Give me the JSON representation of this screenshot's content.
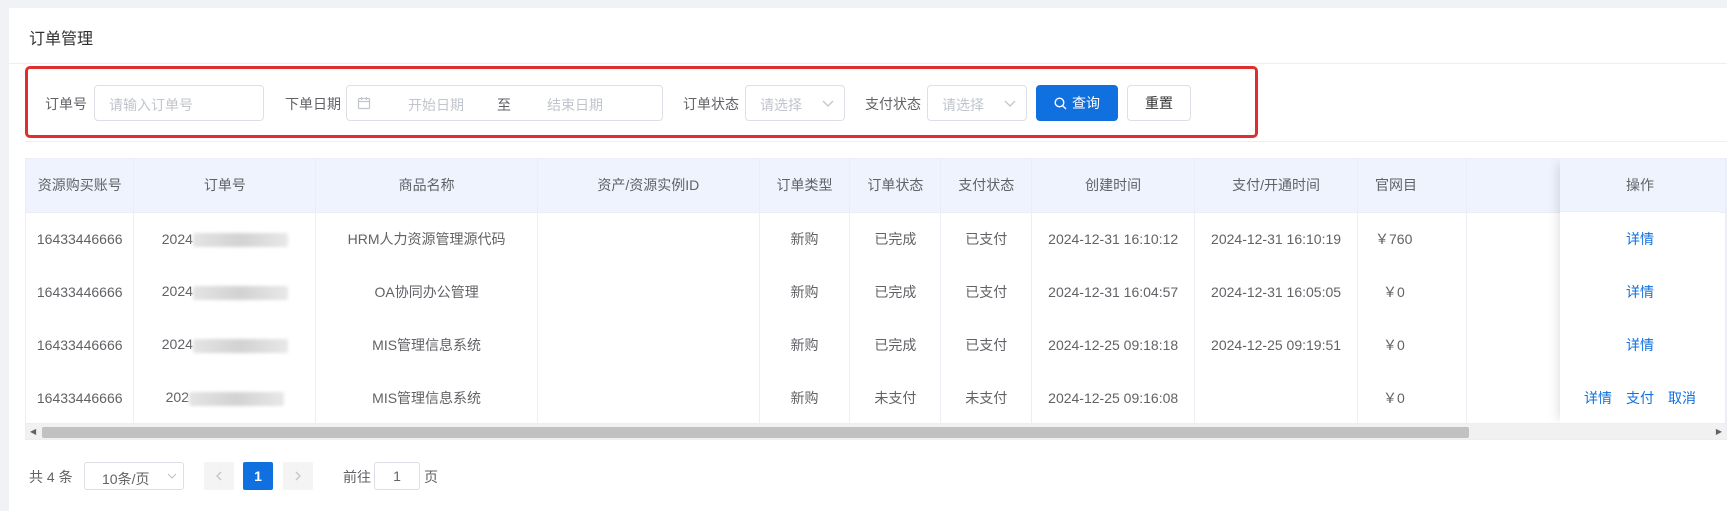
{
  "page": {
    "title": "订单管理"
  },
  "filters": {
    "order_no": {
      "label": "订单号",
      "placeholder": "请输入订单号"
    },
    "order_date": {
      "label": "下单日期",
      "start_placeholder": "开始日期",
      "separator": "至",
      "end_placeholder": "结束日期"
    },
    "order_status": {
      "label": "订单状态",
      "placeholder": "请选择"
    },
    "pay_status": {
      "label": "支付状态",
      "placeholder": "请选择"
    },
    "search_label": "查询",
    "reset_label": "重置"
  },
  "table": {
    "columns": [
      "资源购买账号",
      "订单号",
      "商品名称",
      "资产/资源实例ID",
      "订单类型",
      "订单状态",
      "支付状态",
      "创建时间",
      "支付/开通时间",
      "官网目"
    ],
    "action_header": "操作",
    "rows": [
      {
        "account": "16433446666",
        "order_prefix": "2024",
        "product": "HRM人力资源管理源代码",
        "asset_id": "",
        "type": "新购",
        "status": "已完成",
        "pay": "已支付",
        "created": "2024-12-31 16:10:12",
        "paid": "2024-12-31 16:10:19",
        "price": "￥760",
        "actions": [
          "详情"
        ]
      },
      {
        "account": "16433446666",
        "order_prefix": "2024",
        "product": "OA协同办公管理",
        "asset_id": "",
        "type": "新购",
        "status": "已完成",
        "pay": "已支付",
        "created": "2024-12-31 16:04:57",
        "paid": "2024-12-31 16:05:05",
        "price": "￥0",
        "actions": [
          "详情"
        ]
      },
      {
        "account": "16433446666",
        "order_prefix": "2024",
        "product": "MIS管理信息系统",
        "asset_id": "",
        "type": "新购",
        "status": "已完成",
        "pay": "已支付",
        "created": "2024-12-25 09:18:18",
        "paid": "2024-12-25 09:19:51",
        "price": "￥0",
        "actions": [
          "详情"
        ]
      },
      {
        "account": "16433446666",
        "order_prefix": "202",
        "product": "MIS管理信息系统",
        "asset_id": "",
        "type": "新购",
        "status": "未支付",
        "pay": "未支付",
        "created": "2024-12-25 09:16:08",
        "paid": "",
        "price": "￥0",
        "actions": [
          "详情",
          "支付",
          "取消"
        ]
      }
    ]
  },
  "pagination": {
    "total_text": "共 4 条",
    "page_size": "10条/页",
    "current_page": "1",
    "goto_prefix": "前往",
    "goto_value": "1",
    "goto_suffix": "页"
  },
  "colors": {
    "primary": "#1070e0",
    "highlight_border": "#e02e2e",
    "header_bg": "#eef3fe"
  }
}
